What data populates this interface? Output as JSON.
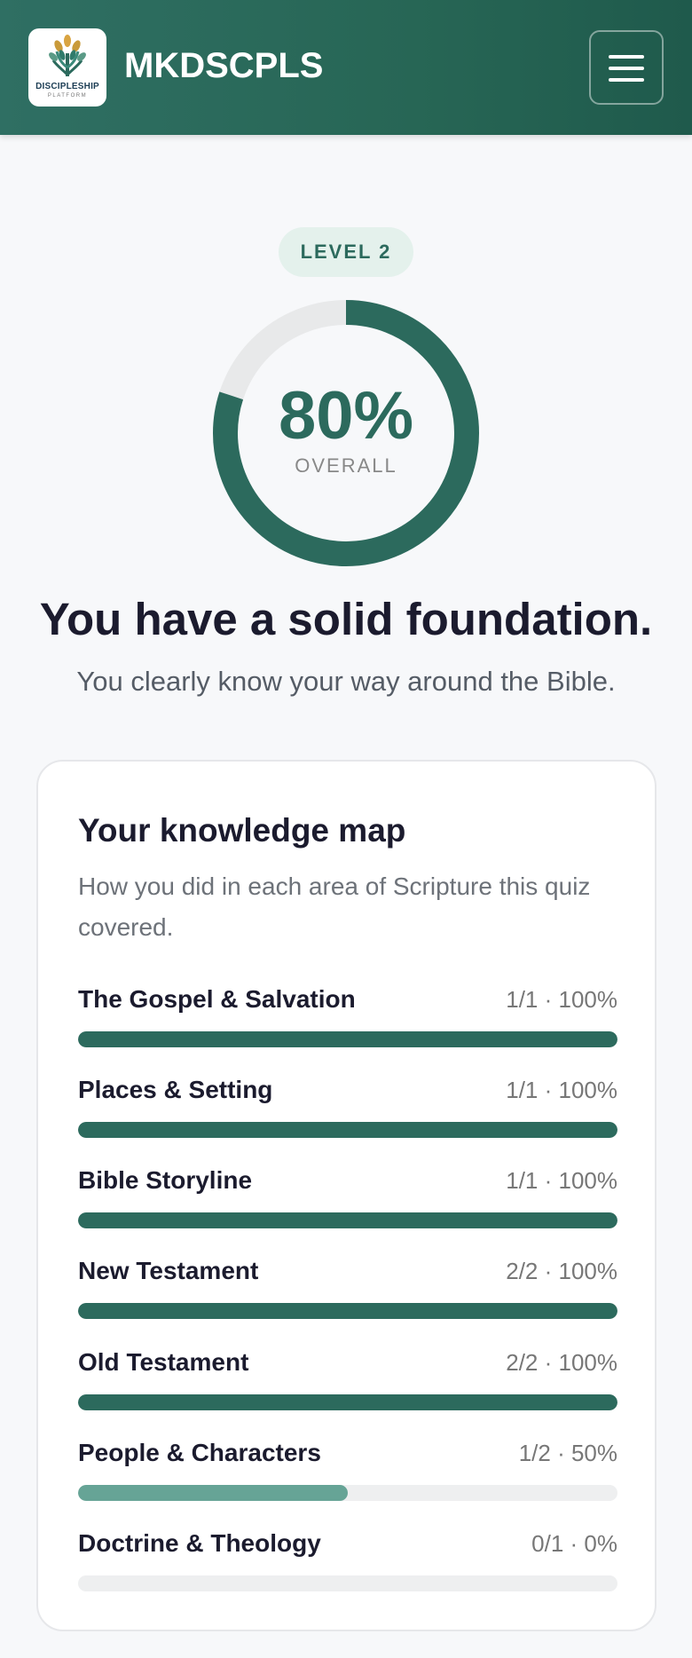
{
  "header": {
    "logo_text": "DISCIPLESHIP",
    "logo_sub": "PLATFORM",
    "brand": "MKDSCPLS"
  },
  "result": {
    "level": "LEVEL 2",
    "percent_text": "80%",
    "percent_value": 80,
    "overall_label": "OVERALL",
    "headline": "You have a solid foundation.",
    "subline": "You clearly know your way around the Bible."
  },
  "knowledge_map": {
    "title": "Your knowledge map",
    "description": "How you did in each area of Scripture this quiz covered.",
    "rows": [
      {
        "label": "The Gospel & Salvation",
        "stat": "1/1 · 100%",
        "percent": 100
      },
      {
        "label": "Places & Setting",
        "stat": "1/1 · 100%",
        "percent": 100
      },
      {
        "label": "Bible Storyline",
        "stat": "1/1 · 100%",
        "percent": 100
      },
      {
        "label": "New Testament",
        "stat": "2/2 · 100%",
        "percent": 100
      },
      {
        "label": "Old Testament",
        "stat": "2/2 · 100%",
        "percent": 100
      },
      {
        "label": "People & Characters",
        "stat": "1/2 · 50%",
        "percent": 50
      },
      {
        "label": "Doctrine & Theology",
        "stat": "0/1 · 0%",
        "percent": 0
      }
    ]
  },
  "colors": {
    "accent": "#2c6a5d",
    "accent_light": "#66a496",
    "track": "#eeeff0"
  }
}
